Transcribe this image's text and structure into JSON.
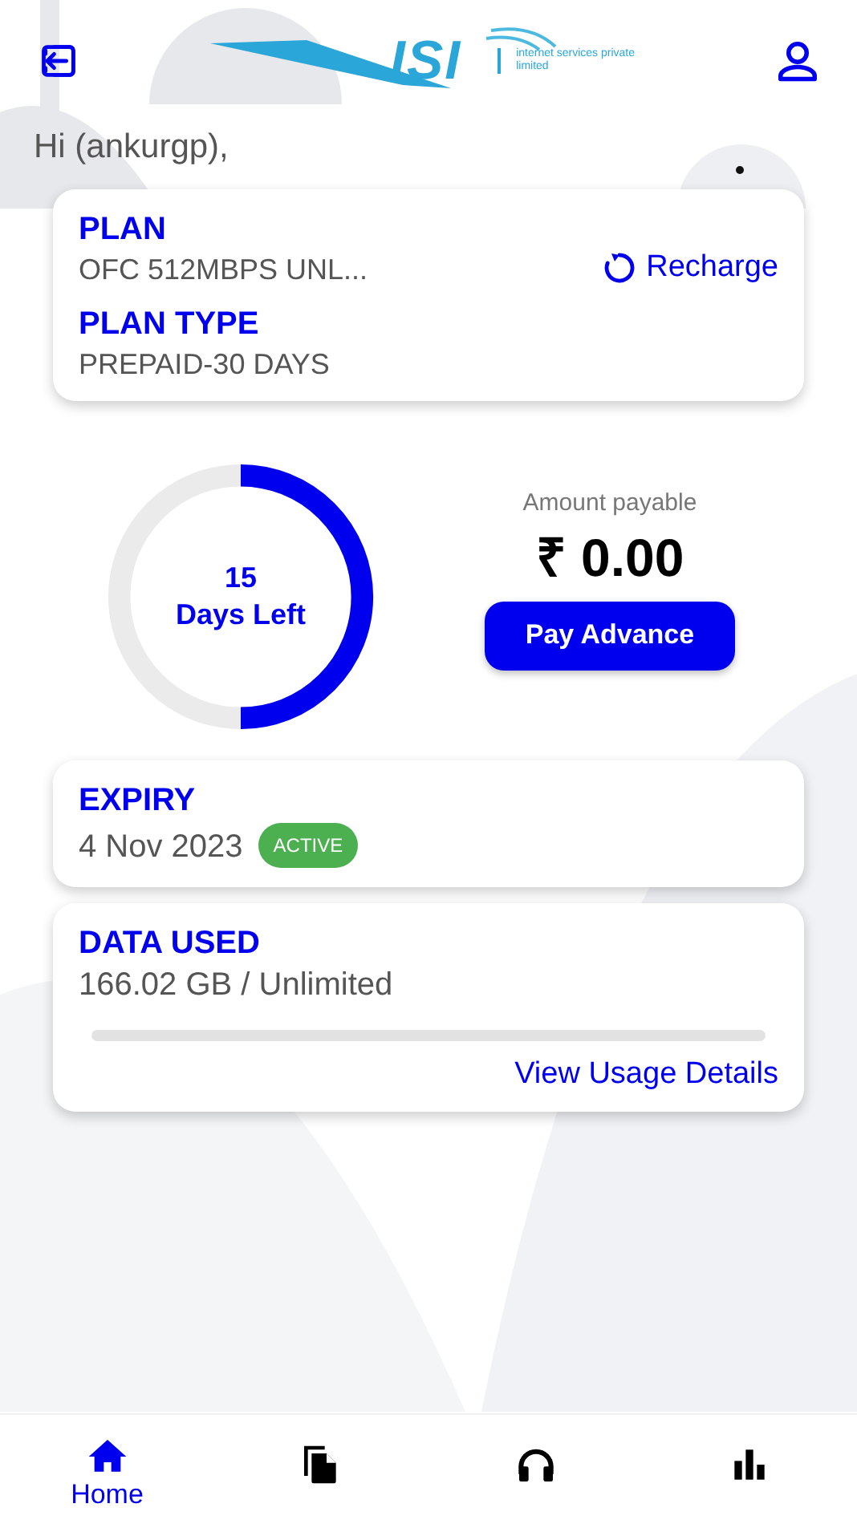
{
  "header": {
    "logo": {
      "mark": "ISI",
      "tagline": "internet services private limited"
    }
  },
  "greeting": "Hi (ankurgp),",
  "plan_card": {
    "plan_label": "PLAN",
    "plan_value": "OFC 512MBPS UNL...",
    "recharge": "Recharge",
    "type_label": "PLAN TYPE",
    "type_value": "PREPAID-30 DAYS"
  },
  "days": {
    "count": "15",
    "label": "Days Left",
    "level": 0.5
  },
  "payment": {
    "label": "Amount payable",
    "amount": "₹ 0.00",
    "button": "Pay Advance"
  },
  "expiry_card": {
    "label": "EXPIRY",
    "date": "4 Nov 2023",
    "status": "ACTIVE"
  },
  "data_card": {
    "label": "DATA USED",
    "value": "166.02 GB / Unlimited",
    "link": "View Usage Details"
  },
  "nav": [
    {
      "kind": "home",
      "label": "Home",
      "selected": true
    },
    {
      "kind": "documents",
      "selected": false
    },
    {
      "kind": "headset",
      "selected": false
    },
    {
      "kind": "chart",
      "selected": false
    }
  ]
}
